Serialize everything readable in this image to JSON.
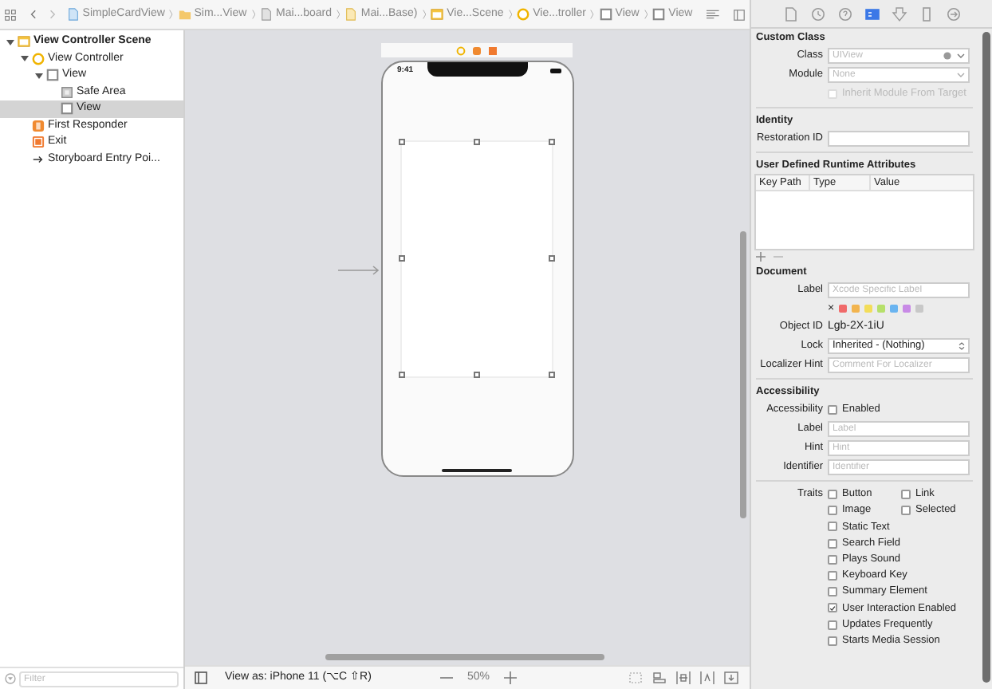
{
  "toolbar": {
    "breadcrumbs": [
      {
        "label": "SimpleCardView",
        "kind": "swiftfile"
      },
      {
        "label": "Sim...View",
        "kind": "folder"
      },
      {
        "label": "Mai...board",
        "kind": "storyboard"
      },
      {
        "label": "Mai...Base)",
        "kind": "basefile"
      },
      {
        "label": "Vie...Scene",
        "kind": "scene"
      },
      {
        "label": "Vie...troller",
        "kind": "controller"
      },
      {
        "label": "View",
        "kind": "view"
      },
      {
        "label": "View",
        "kind": "view"
      }
    ]
  },
  "navigator": {
    "tree": [
      {
        "label": "View Controller Scene",
        "kind": "scene",
        "expanded": true,
        "selected": false,
        "children": [
          {
            "label": "View Controller",
            "kind": "controller",
            "expanded": true,
            "selected": false,
            "children": [
              {
                "label": "View",
                "kind": "view",
                "expanded": true,
                "selected": false,
                "children": [
                  {
                    "label": "Safe Area",
                    "kind": "safearea",
                    "selected": false
                  },
                  {
                    "label": "View",
                    "kind": "view",
                    "selected": true
                  }
                ]
              }
            ]
          },
          {
            "label": "First Responder",
            "kind": "responder",
            "selected": false
          },
          {
            "label": "Exit",
            "kind": "exit",
            "selected": false
          },
          {
            "label": "Storyboard Entry Poi...",
            "kind": "entry",
            "selected": false
          }
        ]
      }
    ],
    "filter": {
      "placeholder": "Filter"
    }
  },
  "canvas": {
    "device": {
      "time": "9:41"
    },
    "bottom_bar": {
      "view_as": "View as: iPhone 11 (⌥C ⇧R)",
      "zoom": "50%"
    }
  },
  "inspector": {
    "tabs": [
      {
        "kind": "file",
        "selected": false
      },
      {
        "kind": "history",
        "selected": false
      },
      {
        "kind": "help",
        "selected": false
      },
      {
        "kind": "identity",
        "selected": true
      },
      {
        "kind": "attributes",
        "selected": false
      },
      {
        "kind": "size",
        "selected": false
      },
      {
        "kind": "connections",
        "selected": false
      }
    ],
    "custom_class": {
      "title": "Custom Class",
      "class_label": "Class",
      "class_placeholder": "UIView",
      "module_label": "Module",
      "module_placeholder": "None",
      "inherit": {
        "label": "Inherit Module From Target",
        "checked": false,
        "disabled": true
      }
    },
    "identity": {
      "title": "Identity",
      "restoration_label": "Restoration ID"
    },
    "runtime_attributes": {
      "title": "User Defined Runtime Attributes",
      "columns": [
        "Key Path",
        "Type",
        "Value"
      ]
    },
    "document": {
      "title": "Document",
      "label_label": "Label",
      "label_placeholder": "Xcode Specific Label",
      "clear": "×",
      "colors": [
        {
          "color": "#f06a6a"
        },
        {
          "color": "#f2b44e"
        },
        {
          "color": "#f3dd5a"
        },
        {
          "color": "#b6e06a"
        },
        {
          "color": "#6ab4f0"
        },
        {
          "color": "#c88ae6"
        },
        {
          "color": "#c8c8c8"
        }
      ],
      "object_id_label": "Object ID",
      "object_id": "Lgb-2X-1iU",
      "lock_label": "Lock",
      "lock_value": "Inherited - (Nothing)",
      "hint_label": "Localizer Hint",
      "hint_placeholder": "Comment For Localizer"
    },
    "accessibility": {
      "title": "Accessibility",
      "enabled_label": "Accessibility",
      "enabled": {
        "label": "Enabled",
        "checked": false
      },
      "fields": [
        {
          "label": "Label",
          "placeholder": "Label"
        },
        {
          "label": "Hint",
          "placeholder": "Hint"
        },
        {
          "label": "Identifier",
          "placeholder": "Identifier"
        }
      ],
      "traits_label": "Traits",
      "traits": [
        {
          "label": "Button",
          "checked": false
        },
        {
          "label": "Link",
          "checked": false
        },
        {
          "label": "Image",
          "checked": false
        },
        {
          "label": "Selected",
          "checked": false
        },
        {
          "label": "Static Text",
          "checked": false
        },
        {
          "label": "Search Field",
          "checked": false
        },
        {
          "label": "Plays Sound",
          "checked": false
        },
        {
          "label": "Keyboard Key",
          "checked": false
        },
        {
          "label": "Summary Element",
          "checked": false
        },
        {
          "label": "User Interaction Enabled",
          "checked": true
        },
        {
          "label": "Updates Frequently",
          "checked": false
        },
        {
          "label": "Starts Media Session",
          "checked": false
        }
      ]
    }
  }
}
